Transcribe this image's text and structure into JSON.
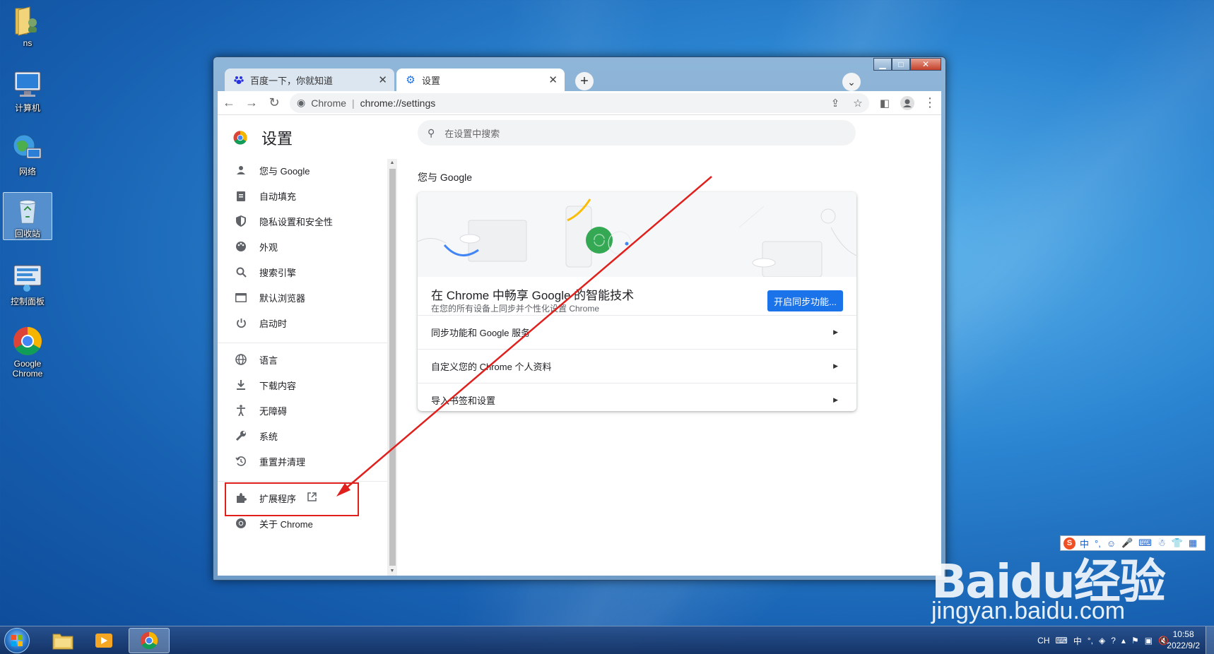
{
  "desktop": {
    "icons": [
      {
        "name": "ns"
      },
      {
        "name": "计算机"
      },
      {
        "name": "网络"
      },
      {
        "name": "回收站"
      },
      {
        "name": "控制面板"
      },
      {
        "name": "Google Chrome"
      }
    ]
  },
  "browser": {
    "tabs": [
      {
        "title": "百度一下，你就知道",
        "active": false
      },
      {
        "title": "设置",
        "active": true
      }
    ],
    "omnibox": {
      "site_label": "Chrome",
      "url": "chrome://settings"
    }
  },
  "settings": {
    "title": "设置",
    "search_placeholder": "在设置中搜索",
    "nav": [
      {
        "label": "您与 Google",
        "icon": "person-icon"
      },
      {
        "label": "自动填充",
        "icon": "clipboard-icon"
      },
      {
        "label": "隐私设置和安全性",
        "icon": "shield-icon"
      },
      {
        "label": "外观",
        "icon": "palette-icon"
      },
      {
        "label": "搜索引擎",
        "icon": "search-icon"
      },
      {
        "label": "默认浏览器",
        "icon": "browser-icon"
      },
      {
        "label": "启动时",
        "icon": "power-icon"
      },
      {
        "label": "语言",
        "icon": "globe-icon"
      },
      {
        "label": "下载内容",
        "icon": "download-icon"
      },
      {
        "label": "无障碍",
        "icon": "accessibility-icon"
      },
      {
        "label": "系统",
        "icon": "wrench-icon"
      },
      {
        "label": "重置并清理",
        "icon": "restore-icon"
      },
      {
        "label": "扩展程序",
        "icon": "puzzle-icon"
      },
      {
        "label": "关于 Chrome",
        "icon": "chrome-icon"
      }
    ],
    "section_title": "您与 Google",
    "promo": {
      "title": "在 Chrome 中畅享 Google 的智能技术",
      "subtitle": "在您的所有设备上同步并个性化设置 Chrome",
      "button": "开启同步功能..."
    },
    "rows": [
      {
        "label": "同步功能和 Google 服务"
      },
      {
        "label": "自定义您的 Chrome 个人资料"
      },
      {
        "label": "导入书签和设置"
      }
    ]
  },
  "watermark": {
    "logo": "Baidu经验",
    "url": "jingyan.baidu.com"
  },
  "ime": {
    "mode": "中"
  },
  "taskbar": {
    "lang": "CH",
    "time": "10:58",
    "date": "2022/9/2"
  },
  "colors": {
    "accent": "#1a73e8",
    "annotation": "#e0201c"
  }
}
